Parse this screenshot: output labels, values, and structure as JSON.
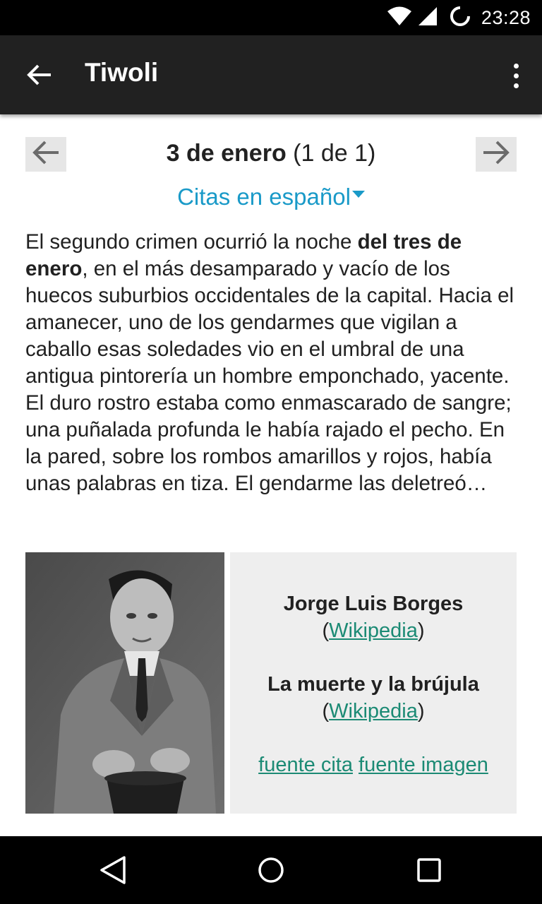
{
  "status_bar": {
    "time": "23:28",
    "icons": [
      "wifi-icon",
      "cell-signal-icon",
      "sync-icon"
    ]
  },
  "app_bar": {
    "title": "Tiwoli",
    "icons": [
      "back-arrow-icon",
      "overflow-menu-icon"
    ]
  },
  "navigation": {
    "date": "3 de enero",
    "count": "(1 de 1)",
    "prev_icon": "arrow-left-icon",
    "next_icon": "arrow-right-icon"
  },
  "language": {
    "selected": "Citas en español"
  },
  "quote": {
    "before": "El segundo crimen ocurrió la noche ",
    "bold": "del tres de enero",
    "after": ", en el más desamparado y vacío de los huecos suburbios occidentales de la capital. Hacia el amanecer, uno de los gendarmes que vigilan a caballo esas soledades vio en el umbral de una antigua pintorería un hombre emponchado, yacente. El duro rostro estaba como enmascarado de sangre; una puñalada profunda le había rajado el pecho. En la pared, sobre los rombos amarillos y rojos, había unas palabras en tiza. El gendarme las deletreó…"
  },
  "attribution": {
    "author": "Jorge Luis Borges",
    "author_link": "Wikipedia",
    "work": "La muerte y la brújula",
    "work_link": "Wikipedia",
    "open_paren": "(",
    "close_paren": ")",
    "source_quote": "fuente cita",
    "source_image": "fuente imagen"
  },
  "nav_bar": {
    "icons": [
      "back-triangle-icon",
      "home-circle-icon",
      "recents-square-icon"
    ]
  },
  "colors": {
    "accent": "#1a9ac8",
    "link": "#1b8a74",
    "app_bar": "#212121"
  }
}
